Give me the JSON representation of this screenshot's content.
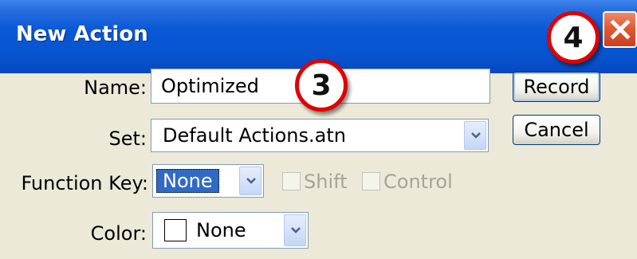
{
  "window": {
    "title": "New Action"
  },
  "callouts": {
    "name_step": "3",
    "record_step": "4"
  },
  "form": {
    "name_label": "Name:",
    "name_value": "Optimized",
    "set_label": "Set:",
    "set_value": "Default Actions.atn",
    "function_key_label": "Function Key:",
    "function_key_value": "None",
    "shift_label": "Shift",
    "shift_checked": false,
    "control_label": "Control",
    "control_checked": false,
    "color_label": "Color:",
    "color_value": "None"
  },
  "buttons": {
    "record": "Record",
    "cancel": "Cancel"
  },
  "icons": {
    "close": "close-icon",
    "dropdown": "chevron-down-icon"
  },
  "colors": {
    "titlebar": "#0754d0",
    "dialog_bg": "#ece9d8",
    "close_button": "#e05a36",
    "callout_border": "#e00000",
    "selection": "#316ac5"
  }
}
